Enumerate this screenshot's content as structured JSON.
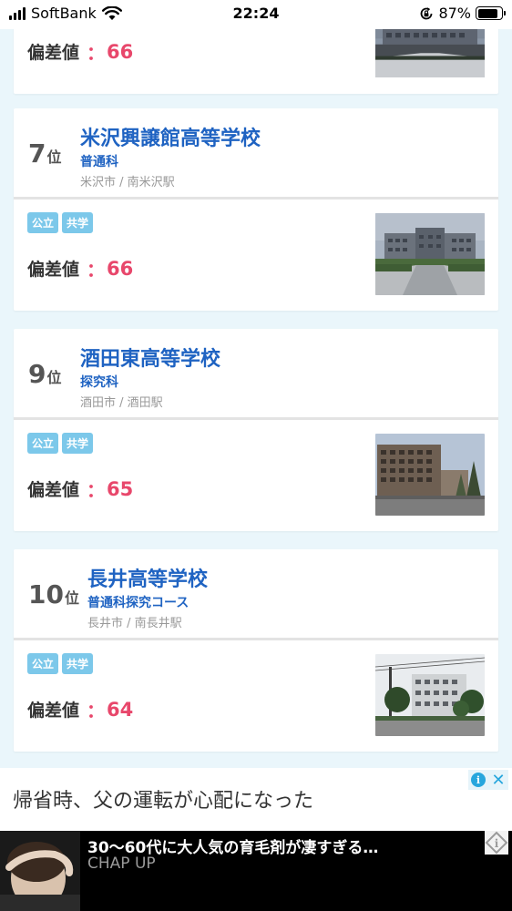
{
  "status_bar": {
    "carrier": "SoftBank",
    "time": "22:24",
    "battery_percent": "87%",
    "battery_level": 0.87
  },
  "top_card": {
    "hensachi_label": "偏差値",
    "colon": "：",
    "hensachi_value": "66"
  },
  "schools": [
    {
      "rank": "7",
      "rank_suffix": "位",
      "name": "米沢興譲館高等学校",
      "course": "普通科",
      "location": "米沢市 / 南米沢駅",
      "tags": [
        "公立",
        "共学"
      ],
      "hensachi_label": "偏差値",
      "colon": "：",
      "hensachi_value": "66"
    },
    {
      "rank": "9",
      "rank_suffix": "位",
      "name": "酒田東高等学校",
      "course": "探究科",
      "location": "酒田市 / 酒田駅",
      "tags": [
        "公立",
        "共学"
      ],
      "hensachi_label": "偏差値",
      "colon": "：",
      "hensachi_value": "65"
    },
    {
      "rank": "10",
      "rank_suffix": "位",
      "name": "長井高等学校",
      "course": "普通科探究コース",
      "location": "長井市 / 南長井駅",
      "tags": [
        "公立",
        "共学"
      ],
      "hensachi_label": "偏差値",
      "colon": "：",
      "hensachi_value": "64"
    }
  ],
  "ad": {
    "headline": "帰省時、父の運転が心配になった",
    "info_glyph": "i",
    "close_glyph": "✕",
    "banner_title": "30〜60代に大人気の育毛剤が凄すぎる…",
    "banner_brand": "CHAP UP"
  },
  "colors": {
    "school_name": "#1f63c2",
    "hensachi": "#e8476b",
    "tag": "#7cc8ea",
    "background": "#eaf6fb"
  }
}
